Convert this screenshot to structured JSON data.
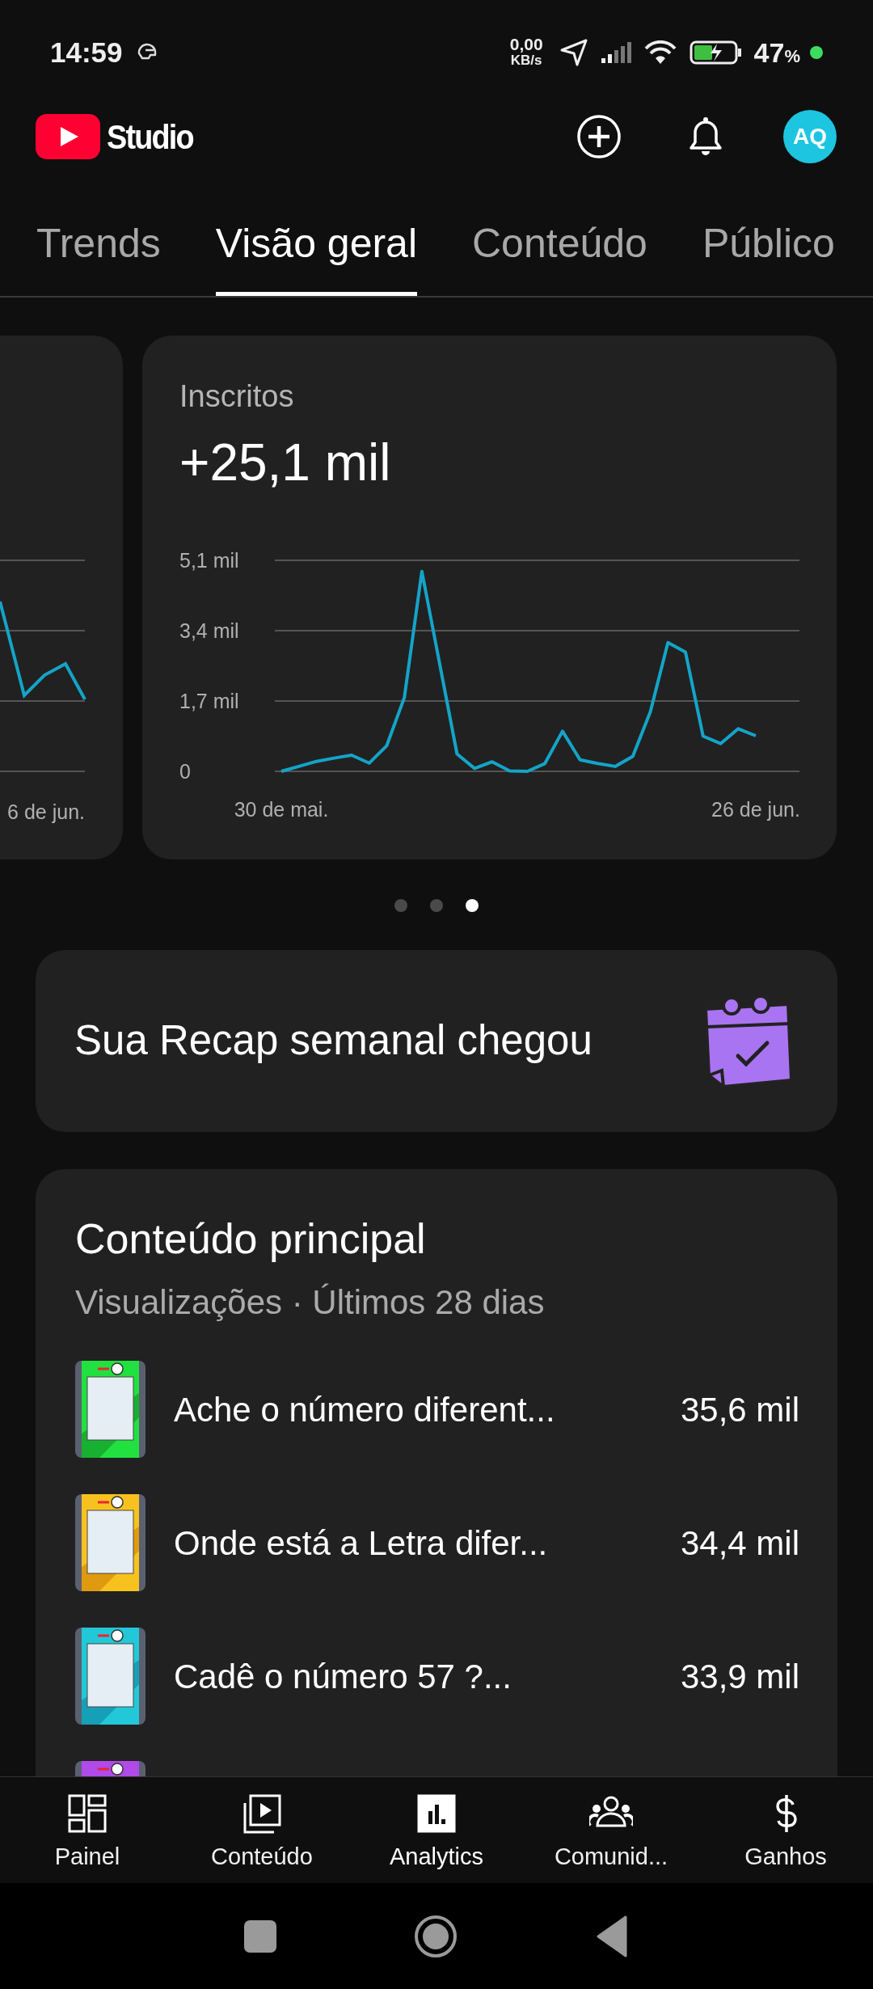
{
  "status_bar": {
    "time": "14:59",
    "network_speed": "0,00",
    "network_unit": "KB/s",
    "battery": "47",
    "battery_unit": "%"
  },
  "header": {
    "app_name": "Studio",
    "avatar": "AQ"
  },
  "tabs": [
    {
      "label": "Trends",
      "selected": false
    },
    {
      "label": "Visão geral",
      "selected": true
    },
    {
      "label": "Conteúdo",
      "selected": false
    },
    {
      "label": "Público",
      "selected": false
    }
  ],
  "carousel": {
    "previous_card": {
      "x_label": "6 de jun."
    },
    "card": {
      "title": "Inscritos",
      "value": "+25,1 mil",
      "chart_data": {
        "type": "line",
        "categories": [
          "30 de mai.",
          null,
          null,
          null,
          null,
          null,
          null,
          null,
          null,
          null,
          null,
          null,
          null,
          null,
          null,
          null,
          null,
          null,
          null,
          null,
          null,
          null,
          null,
          null,
          null,
          null,
          null,
          "26 de jun."
        ],
        "ylim": [
          0,
          5.1
        ],
        "yticks": [
          {
            "value": 0,
            "label": "0"
          },
          {
            "value": 1.7,
            "label": "1,7 mil"
          },
          {
            "value": 3.4,
            "label": "3,4 mil"
          },
          {
            "value": 5.1,
            "label": "5,1 mil"
          }
        ],
        "series": [
          {
            "color": "#14a4c8",
            "values": [
              0,
              0.12,
              0.24,
              0.32,
              0.39,
              0.2,
              0.62,
              1.78,
              4.83,
              2.62,
              0.42,
              0.07,
              0.23,
              0.01,
              0,
              0.19,
              0.97,
              0.28,
              0.19,
              0.12,
              0.36,
              1.44,
              3.11,
              2.88,
              0.85,
              0.67,
              1.03,
              0.86
            ]
          }
        ]
      }
    },
    "pages": [
      {
        "selected": false
      },
      {
        "selected": false
      },
      {
        "selected": true
      }
    ]
  },
  "recap": {
    "text": "Sua Recap semanal chegou"
  },
  "top_content": {
    "title": "Conteúdo principal",
    "subtitle": "Visualizações · Últimos 28 dias",
    "items": [
      {
        "title": "Ache o número diferent...",
        "views": "35,6 mil"
      },
      {
        "title": "Onde está a Letra difer...",
        "views": "34,4 mil"
      },
      {
        "title": "Cadê o número 57 ?...",
        "views": "33,9 mil"
      }
    ]
  },
  "bottom_nav": [
    {
      "label": "Painel",
      "selected": false
    },
    {
      "label": "Conteúdo",
      "selected": false
    },
    {
      "label": "Analytics",
      "selected": true
    },
    {
      "label": "Comunid...",
      "selected": false
    },
    {
      "label": "Ganhos",
      "selected": false
    }
  ]
}
